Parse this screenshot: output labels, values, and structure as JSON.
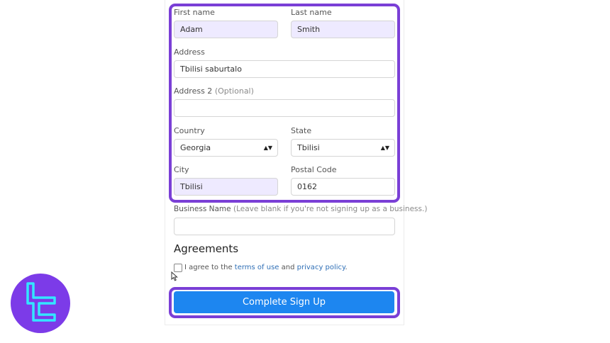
{
  "form": {
    "first_name": {
      "label": "First name",
      "value": "Adam"
    },
    "last_name": {
      "label": "Last name",
      "value": "Smith"
    },
    "address": {
      "label": "Address",
      "value": "Tbilisi saburtalo"
    },
    "address2": {
      "label": "Address 2",
      "optional": "(Optional)",
      "value": ""
    },
    "country": {
      "label": "Country",
      "value": "Georgia"
    },
    "state": {
      "label": "State",
      "value": "Tbilisi"
    },
    "city": {
      "label": "City",
      "value": "Tbilisi"
    },
    "postal_code": {
      "label": "Postal Code",
      "value": "0162"
    },
    "business_name": {
      "label": "Business Name",
      "hint": "(Leave blank if you're not signing up as a business.)",
      "value": ""
    }
  },
  "agreements": {
    "heading": "Agreements",
    "text_prefix": "I agree to the",
    "terms_link": "terms of use",
    "and": "and",
    "privacy_link": "privacy policy",
    "suffix": "."
  },
  "submit_label": "Complete Sign Up",
  "colors": {
    "highlight": "#7a3fd6",
    "button": "#1d86f0",
    "filled_input": "#eeeaff",
    "logo_bg": "#7c3be8",
    "logo_stroke": "#33e6ff"
  }
}
